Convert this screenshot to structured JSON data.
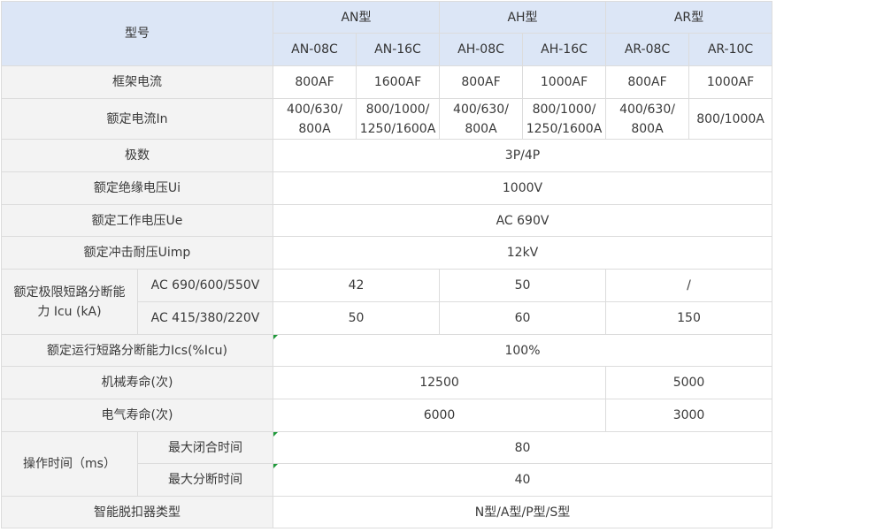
{
  "header": {
    "model_label": "型号",
    "groups": [
      "AN型",
      "AH型",
      "AR型"
    ],
    "models": [
      "AN-08C",
      "AN-16C",
      "AH-08C",
      "AH-16C",
      "AR-08C",
      "AR-10C"
    ]
  },
  "rows": {
    "frame_current": {
      "label": "框架电流",
      "values": [
        "800AF",
        "1600AF",
        "800AF",
        "1000AF",
        "800AF",
        "1000AF"
      ]
    },
    "rated_current": {
      "label": "额定电流In",
      "values": [
        [
          "400/630/",
          "800A"
        ],
        [
          "800/1000/",
          "1250/1600A"
        ],
        [
          "400/630/",
          "800A"
        ],
        [
          "800/1000/",
          "1250/1600A"
        ],
        [
          "400/630/",
          "800A"
        ],
        [
          "800/1000A"
        ]
      ]
    },
    "poles": {
      "label": "极数",
      "value": "3P/4P"
    },
    "insulation_voltage": {
      "label": "额定绝缘电压Ui",
      "value": "1000V"
    },
    "operating_voltage": {
      "label": "额定工作电压Ue",
      "value": "AC 690V"
    },
    "impulse_voltage": {
      "label": "额定冲击耐压Uimp",
      "value": "12kV"
    },
    "ultimate_breaking": {
      "label": [
        "额定极限短路分断能",
        "力 Icu (kA)"
      ],
      "sub": [
        {
          "label": "AC 690/600/550V",
          "values": [
            "42",
            "50",
            "/"
          ]
        },
        {
          "label": "AC 415/380/220V",
          "values": [
            "50",
            "60",
            "150"
          ]
        }
      ]
    },
    "service_breaking": {
      "label": "额定运行短路分断能力Ics(%Icu)",
      "value": "100%"
    },
    "mechanical_life": {
      "label": "机械寿命(次)",
      "values": [
        "12500",
        "5000"
      ]
    },
    "electrical_life": {
      "label": "电气寿命(次)",
      "values": [
        "6000",
        "3000"
      ]
    },
    "operating_time": {
      "label": "操作时间（ms）",
      "sub": [
        {
          "label": "最大闭合时间",
          "value": "80"
        },
        {
          "label": "最大分断时间",
          "value": "40"
        }
      ]
    },
    "trip_unit": {
      "label": "智能脱扣器类型",
      "value": "N型/A型/P型/S型"
    }
  }
}
